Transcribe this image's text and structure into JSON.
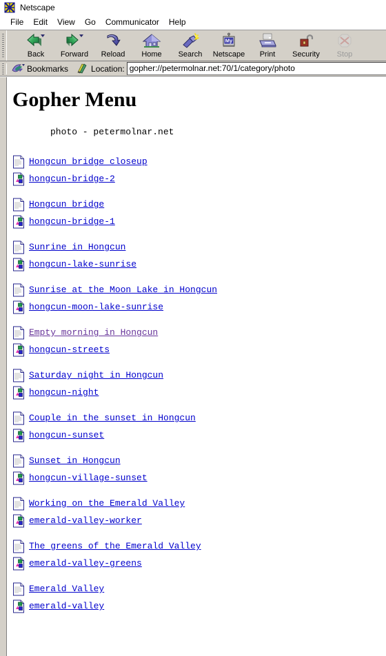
{
  "window": {
    "title": "Netscape",
    "title_icon": "netscape-n-logo-icon"
  },
  "menubar": {
    "items": [
      {
        "label": "File"
      },
      {
        "label": "Edit"
      },
      {
        "label": "View"
      },
      {
        "label": "Go"
      },
      {
        "label": "Communicator"
      },
      {
        "label": "Help"
      }
    ]
  },
  "toolbar": {
    "buttons": [
      {
        "label": "Back",
        "icon": "back-arrow-icon",
        "disabled": false,
        "has_dropdown": true
      },
      {
        "label": "Forward",
        "icon": "forward-arrow-icon",
        "disabled": false,
        "has_dropdown": true
      },
      {
        "label": "Reload",
        "icon": "reload-arrow-icon",
        "disabled": false,
        "has_dropdown": false
      },
      {
        "label": "Home",
        "icon": "home-house-icon",
        "disabled": false,
        "has_dropdown": false
      },
      {
        "label": "Search",
        "icon": "search-flashlight-icon",
        "disabled": false,
        "has_dropdown": false
      },
      {
        "label": "Netscape",
        "icon": "my-netscape-icon",
        "disabled": false,
        "has_dropdown": false
      },
      {
        "label": "Print",
        "icon": "printer-icon",
        "disabled": false,
        "has_dropdown": false
      },
      {
        "label": "Security",
        "icon": "open-padlock-icon",
        "disabled": false,
        "has_dropdown": false
      },
      {
        "label": "Stop",
        "icon": "stop-sign-icon",
        "disabled": true,
        "has_dropdown": false
      }
    ]
  },
  "locationbar": {
    "bookmarks_label": "Bookmarks",
    "bookmarks_icon": "bookmark-bird-icon",
    "location_label": "Location:",
    "location_icon": "location-compass-icon",
    "url": "gopher://petermolnar.net:70/1/category/photo"
  },
  "page": {
    "heading": "Gopher Menu",
    "subtitle": "photo - petermolnar.net",
    "groups": [
      {
        "title": {
          "text": "Hongcun bridge closeup",
          "icon": "text-document-icon",
          "visited": false
        },
        "image": {
          "text": "hongcun-bridge-2",
          "icon": "image-file-icon",
          "visited": false
        }
      },
      {
        "title": {
          "text": "Hongcun bridge",
          "icon": "text-document-icon",
          "visited": false
        },
        "image": {
          "text": "hongcun-bridge-1",
          "icon": "image-file-icon",
          "visited": false
        }
      },
      {
        "title": {
          "text": "Sunrine in Hongcun",
          "icon": "text-document-icon",
          "visited": false
        },
        "image": {
          "text": "hongcun-lake-sunrise",
          "icon": "image-file-icon",
          "visited": false
        }
      },
      {
        "title": {
          "text": "Sunrise at the Moon Lake in Hongcun",
          "icon": "text-document-icon",
          "visited": false
        },
        "image": {
          "text": "hongcun-moon-lake-sunrise",
          "icon": "image-file-icon",
          "visited": false
        }
      },
      {
        "title": {
          "text": "Empty morning in Hongcun",
          "icon": "text-document-icon",
          "visited": true
        },
        "image": {
          "text": "hongcun-streets",
          "icon": "image-file-icon",
          "visited": false
        }
      },
      {
        "title": {
          "text": "Saturday night in Hongcun",
          "icon": "text-document-icon",
          "visited": false
        },
        "image": {
          "text": "hongcun-night",
          "icon": "image-file-icon",
          "visited": false
        }
      },
      {
        "title": {
          "text": "Couple in the sunset in Hongcun",
          "icon": "text-document-icon",
          "visited": false
        },
        "image": {
          "text": "hongcun-sunset",
          "icon": "image-file-icon",
          "visited": false
        }
      },
      {
        "title": {
          "text": "Sunset in Hongcun",
          "icon": "text-document-icon",
          "visited": false
        },
        "image": {
          "text": "hongcun-village-sunset",
          "icon": "image-file-icon",
          "visited": false
        }
      },
      {
        "title": {
          "text": "Working on the Emerald Valley",
          "icon": "text-document-icon",
          "visited": false
        },
        "image": {
          "text": "emerald-valley-worker",
          "icon": "image-file-icon",
          "visited": false
        }
      },
      {
        "title": {
          "text": "The greens of the Emerald Valley",
          "icon": "text-document-icon",
          "visited": false
        },
        "image": {
          "text": "emerald-valley-greens",
          "icon": "image-file-icon",
          "visited": false
        }
      },
      {
        "title": {
          "text": "Emerald Valley",
          "icon": "text-document-icon",
          "visited": false
        },
        "image": {
          "text": "emerald-valley",
          "icon": "image-file-icon",
          "visited": false
        }
      }
    ]
  },
  "colors": {
    "link": "#0000cc",
    "visited_link": "#663399",
    "chrome": "#d4d0c8",
    "page_bg": "#ffffff"
  }
}
